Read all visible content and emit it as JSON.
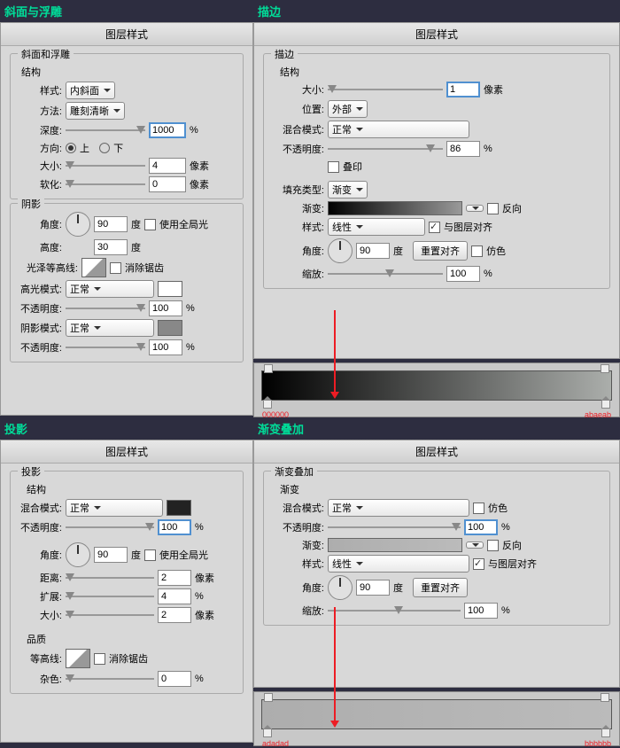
{
  "t": {
    "bevel": "斜面与浮雕",
    "stroke": "描边",
    "shadow": "投影",
    "gradov": "渐变叠加"
  },
  "hdr": "图层样式",
  "g": {
    "bevel": "斜面和浮雕",
    "struct": "结构",
    "shade": "阴影",
    "quality": "品质",
    "stroke": "描边",
    "grad": "渐变",
    "gradov": "渐变叠加",
    "shadow": "投影",
    "fill": "填充类型:"
  },
  "l": {
    "style": "样式:",
    "method": "方法:",
    "depth": "深度:",
    "dir": "方向:",
    "size": "大小:",
    "soften": "软化:",
    "angle": "角度:",
    "altitude": "高度:",
    "gloss": "光泽等高线:",
    "hmode": "高光模式:",
    "opacity": "不透明度:",
    "smode": "阴影模式:",
    "pos": "位置:",
    "blend": "混合模式:",
    "overprint": "叠印",
    "gradient": "渐变:",
    "scale": "缩放:",
    "dist": "距离:",
    "spread": "扩展:",
    "contour": "等高线:",
    "noise": "杂色:"
  },
  "v": {
    "inner": "内斜面",
    "carve": "雕刻清晰",
    "up": "上",
    "down": "下",
    "normal": "正常",
    "outside": "外部",
    "linear": "线性",
    "grad": "渐变"
  },
  "c": {
    "global": "使用全局光",
    "antialias": "消除锯齿",
    "reverse": "反向",
    "align": "与图层对齐",
    "dither": "仿色",
    "reset": "重置对齐"
  },
  "u": {
    "px": "像素",
    "pct": "%",
    "deg": "度"
  },
  "n": {
    "d1000": "1000",
    "d4": "4",
    "d0": "0",
    "d90": "90",
    "d30": "30",
    "d100": "100",
    "d1": "1",
    "d86": "86",
    "d2": "2"
  },
  "colors": {
    "g1a": "000000",
    "g1b": "abaeab",
    "g2a": "adadad",
    "g2b": "bbbbbb"
  }
}
